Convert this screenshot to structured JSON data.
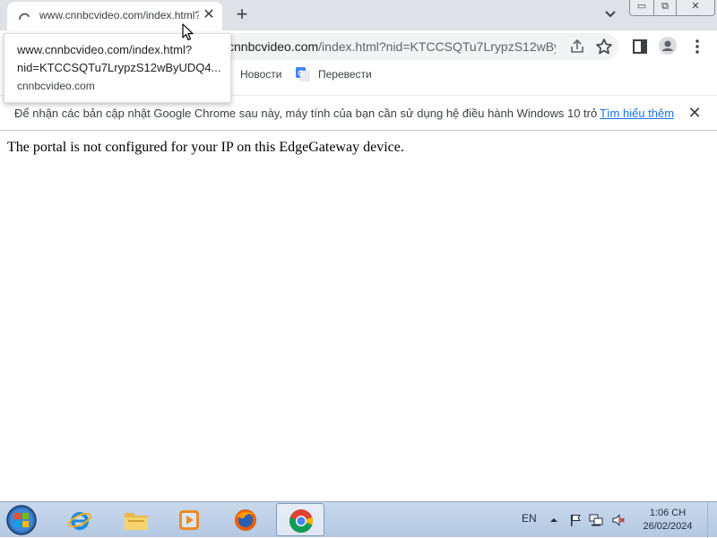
{
  "browser": {
    "tab": {
      "title": "www.cnnbcvideo.com/index.html?nid=KTCCSQTu7LrypzS12wByUDQ4",
      "close_label": "✕"
    },
    "new_tab_label": "+",
    "window_controls": {
      "minimize": "▭",
      "maximize": "⧉",
      "close": "✕"
    },
    "address": {
      "host": "cnnbcvideo.com",
      "path": "/index.html?nid=KTCCSQTu7LrypzS12wBy..."
    },
    "bookmarks": [
      {
        "label": "Новости"
      },
      {
        "label": "Перевести"
      }
    ],
    "infobar": {
      "message": "Để nhận các bản cập nhật Google Chrome sau này, máy tính của bạn cần sử dụng hệ điều hành Windows 10 trở...",
      "link": "Tìm hiểu thêm",
      "close_label": "✕"
    },
    "tooltip": {
      "line1": "www.cnnbcvideo.com/index.html?",
      "line2": "nid=KTCCSQTu7LrypzS12wByUDQ4...",
      "line3": "cnnbcvideo.com"
    }
  },
  "page": {
    "message": "The portal is not configured for your IP on this EdgeGateway device."
  },
  "taskbar": {
    "apps": [
      "start",
      "internet-explorer",
      "file-explorer",
      "media-player",
      "firefox",
      "chrome"
    ],
    "active_app": "chrome",
    "language": "EN",
    "time": "1:06 CH",
    "date": "26/02/2024"
  },
  "colors": {
    "tabstrip": "#dee1e6",
    "omnibox": "#f1f3f4",
    "link": "#1a73e8",
    "taskbar": "#c9d9ec"
  }
}
